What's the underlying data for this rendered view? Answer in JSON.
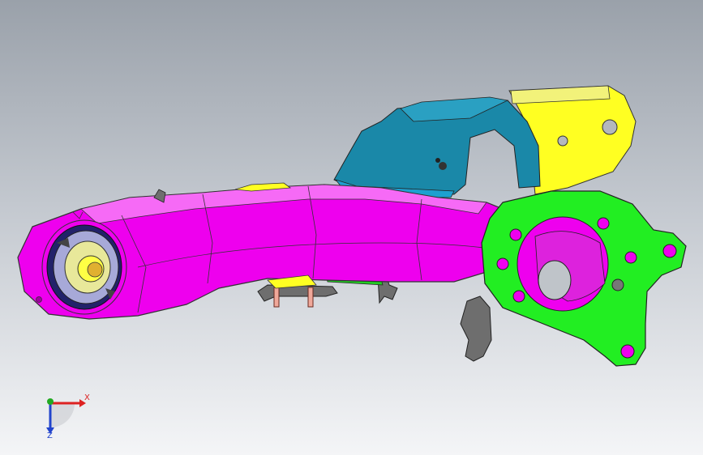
{
  "viewport": {
    "background_top": "#9aa1aa",
    "background_bottom": "#f4f5f7"
  },
  "model": {
    "parts": [
      {
        "name": "trailing-arm",
        "color": "#ee00ee"
      },
      {
        "name": "knuckle-flange",
        "color": "#22ee22"
      },
      {
        "name": "mount-bracket",
        "color": "#ffff22"
      },
      {
        "name": "support-bracket",
        "color": "#1a88a8"
      },
      {
        "name": "bushing",
        "color": "#e8e89a"
      },
      {
        "name": "clip-bracket",
        "color": "#6e6e6e"
      }
    ]
  },
  "triad": {
    "x_label": "X",
    "z_label": "Z",
    "x_color": "#dd2222",
    "y_color": "#22aa22",
    "z_color": "#2244cc"
  }
}
